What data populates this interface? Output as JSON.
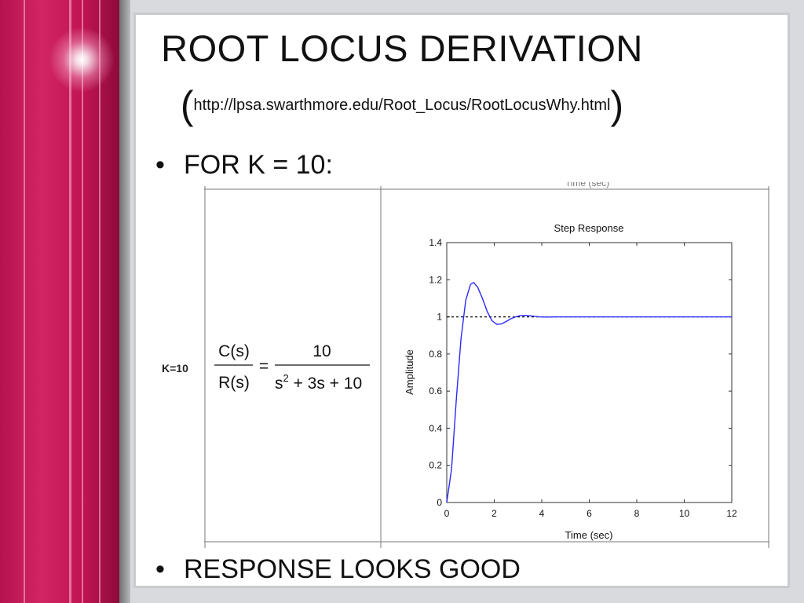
{
  "slide": {
    "title": "ROOT LOCUS DERIVATION",
    "paren_open": "(",
    "source_url": "http://lpsa.swarthmore.edu/Root_Locus/RootLocusWhy.html",
    "paren_close": ")",
    "bullets": [
      {
        "marker": "•",
        "text": "FOR K = 10:"
      },
      {
        "marker": "•",
        "text": "RESPONSE LOOKS GOOD"
      }
    ]
  },
  "figure": {
    "cropped_header": "Time (sec)",
    "k_label": "K=10",
    "tf_lhs_num": "C(s)",
    "tf_lhs_den": "R(s)",
    "equals": "=",
    "tf_rhs_num": "10",
    "tf_den_s": "s",
    "tf_den_exp": "2",
    "tf_den_rest": " + 3s + 10"
  },
  "chart_data": {
    "type": "line",
    "title": "Step Response",
    "xlabel": "Time (sec)",
    "ylabel": "Amplitude",
    "xlim": [
      0,
      12
    ],
    "ylim": [
      0,
      1.4
    ],
    "xticks": [
      0,
      2,
      4,
      6,
      8,
      10,
      12
    ],
    "xtick_labels": [
      "0",
      "2",
      "4",
      "6",
      "8",
      "10",
      "12"
    ],
    "yticks": [
      0,
      0.2,
      0.4,
      0.6,
      0.8,
      1,
      1.2,
      1.4
    ],
    "ytick_labels": [
      "0",
      "0.2",
      "0.4",
      "0.6",
      "0.8",
      "1",
      "1.2",
      "1.4"
    ],
    "grid": false,
    "series": [
      {
        "color": "#2a2aff",
        "style": "solid",
        "x": [
          0,
          0.2,
          0.4,
          0.6,
          0.8,
          1.0,
          1.13,
          1.3,
          1.5,
          1.7,
          1.9,
          2.1,
          2.3,
          2.5,
          2.7,
          2.9,
          3.1,
          3.3,
          3.5,
          3.7,
          3.9,
          4.2,
          4.6,
          5,
          6,
          8,
          10,
          12
        ],
        "y": [
          0,
          0.18,
          0.55,
          0.88,
          1.09,
          1.175,
          1.185,
          1.16,
          1.1,
          1.03,
          0.98,
          0.96,
          0.962,
          0.975,
          0.99,
          1.0,
          1.007,
          1.008,
          1.006,
          1.003,
          1.0,
          0.999,
          1.0,
          1.0,
          1.0,
          1.0,
          1.0,
          1.0
        ]
      },
      {
        "color": "#000000",
        "style": "dashed",
        "x": [
          0,
          12
        ],
        "y": [
          1,
          1
        ]
      }
    ]
  }
}
